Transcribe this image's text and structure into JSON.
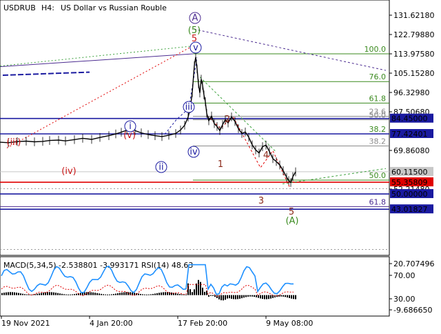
{
  "header": {
    "symbol": "USDRUB",
    "timeframe": "H4:",
    "description": "US Dollar vs Russian Rouble"
  },
  "colors": {
    "fib_green": "#3a8a1e",
    "line_blue": "#1a1aa0",
    "line_red": "#e00000",
    "wave_red": "#c81414",
    "wave_brown": "#8b2a1a",
    "wave_purple": "#4b2b90",
    "label_blue_bg": "#1a1aa0",
    "label_red_bg": "#e00000",
    "label_gray_bg": "#c8c8c8",
    "macd_blue": "#1e90ff"
  },
  "price_axis": [
    {
      "value": 131.6218,
      "text": "131.62180"
    },
    {
      "value": 122.7988,
      "text": "122.79880"
    },
    {
      "value": 113.9758,
      "text": "113.97580"
    },
    {
      "value": 105.1528,
      "text": "105.15280"
    },
    {
      "value": 96.3298,
      "text": "96.32980"
    },
    {
      "value": 87.5068,
      "text": "87.50680"
    },
    {
      "value": 69.8608,
      "text": "69.86080"
    },
    {
      "value": 52.2148,
      "text": "52.21480"
    }
  ],
  "price_labels": [
    {
      "value": 84.45,
      "text": "84.45000",
      "kind": "blue"
    },
    {
      "value": 77.42401,
      "text": "77.42401",
      "kind": "blue"
    },
    {
      "value": 60.115,
      "text": "60.11500",
      "kind": "gray"
    },
    {
      "value": 55.35809,
      "text": "55.35809",
      "kind": "red"
    },
    {
      "value": 50.0,
      "text": "50.00000",
      "kind": "blue"
    },
    {
      "value": 43.01827,
      "text": "43.01827",
      "kind": "blue"
    }
  ],
  "fib_levels": [
    {
      "value": 113.9758,
      "text": "100.0",
      "color": "green"
    },
    {
      "value": 101.3,
      "text": "76.0",
      "color": "green"
    },
    {
      "value": 91.5,
      "text": "61.8",
      "color": "green"
    },
    {
      "value": 85.45,
      "text": "23.6",
      "color": "gray"
    },
    {
      "value": 83.9,
      "text": "50.0",
      "color": "gray"
    },
    {
      "value": 77.42401,
      "text": "38.2",
      "color": "green"
    },
    {
      "value": 71.9,
      "text": "38.2",
      "color": "gray"
    },
    {
      "value": 56.3,
      "text": "50.0",
      "color": "green"
    },
    {
      "value": 44.2,
      "text": "61.8",
      "color": "purple"
    }
  ],
  "wave_labels": [
    {
      "text": "A",
      "style": "circle-purple"
    },
    {
      "text": "(5)",
      "style": "green"
    },
    {
      "text": "5",
      "style": "red"
    },
    {
      "text": "v",
      "style": "circle-blue"
    },
    {
      "text": "iii",
      "style": "circle-blue"
    },
    {
      "text": "i",
      "style": "circle-blue"
    },
    {
      "text": "ii",
      "style": "circle-blue"
    },
    {
      "text": "iv",
      "style": "circle-blue"
    },
    {
      "text": "(iii)",
      "style": "red"
    },
    {
      "text": "(v)",
      "style": "red"
    },
    {
      "text": "(iv)",
      "style": "red"
    },
    {
      "text": "1",
      "style": "brown"
    },
    {
      "text": "2",
      "style": "brown"
    },
    {
      "text": "3",
      "style": "brown"
    },
    {
      "text": "4",
      "style": "brown"
    },
    {
      "text": "5",
      "style": "brown"
    },
    {
      "text": "(A)",
      "style": "green"
    }
  ],
  "macd": {
    "label": "MACD(5,34,5) -2.538801 -3.993171 RSI(14) 48.63",
    "axis": [
      {
        "value": 20.707496,
        "text": "20.707496"
      },
      {
        "value": 70.0,
        "text": "70.00"
      },
      {
        "value": 30.0,
        "text": "30.00"
      },
      {
        "value": -9.68665,
        "text": "-9.686650"
      }
    ]
  },
  "time_axis": [
    "19 Nov 2021",
    "4 Jan 20:00",
    "17 Feb 20:00",
    "9 May 08:00"
  ],
  "chart_data": {
    "type": "line",
    "title": "USDRUB, H4: US Dollar vs Russian Rouble",
    "ylim": [
      38.0,
      133.0
    ],
    "x": [
      "19 Nov 2021",
      "4 Jan 20:00",
      "17 Feb 20:00",
      "9 May 08:00"
    ],
    "series": [
      {
        "name": "USDRUB",
        "points": [
          [
            0,
            73.6
          ],
          [
            12,
            73.4
          ],
          [
            25,
            73.9
          ],
          [
            38,
            74.1
          ],
          [
            50,
            73.8
          ],
          [
            62,
            74.0
          ],
          [
            72,
            74.4
          ],
          [
            85,
            74.6
          ],
          [
            95,
            74.2
          ],
          [
            108,
            74.8
          ],
          [
            120,
            75.4
          ],
          [
            133,
            74.9
          ],
          [
            145,
            75.8
          ],
          [
            158,
            76.6
          ],
          [
            168,
            77.4
          ],
          [
            176,
            78.2
          ],
          [
            184,
            79.1
          ],
          [
            190,
            80.6
          ],
          [
            196,
            78.9
          ],
          [
            205,
            77.9
          ],
          [
            215,
            77.1
          ],
          [
            225,
            76.6
          ],
          [
            235,
            76.2
          ],
          [
            245,
            76.8
          ],
          [
            255,
            77.6
          ],
          [
            262,
            79.2
          ],
          [
            268,
            81.4
          ],
          [
            273,
            85.1
          ],
          [
            276,
            88.9
          ],
          [
            279,
            96.2
          ],
          [
            282,
            108.6
          ],
          [
            284,
            112.5
          ],
          [
            286,
            107.1
          ],
          [
            288,
            100.3
          ],
          [
            290,
            96.1
          ],
          [
            292,
            102.4
          ],
          [
            294,
            99.6
          ],
          [
            296,
            95.2
          ],
          [
            298,
            92.1
          ],
          [
            300,
            86.8
          ],
          [
            303,
            83.4
          ],
          [
            307,
            85.6
          ],
          [
            311,
            82.1
          ],
          [
            315,
            80.8
          ],
          [
            319,
            78.9
          ],
          [
            323,
            81.6
          ],
          [
            327,
            83.9
          ],
          [
            331,
            82.4
          ],
          [
            336,
            85.2
          ],
          [
            341,
            83.1
          ],
          [
            346,
            79.8
          ],
          [
            351,
            77.6
          ],
          [
            356,
            78.3
          ],
          [
            361,
            75.9
          ],
          [
            366,
            72.4
          ],
          [
            371,
            70.1
          ],
          [
            376,
            68.7
          ],
          [
            381,
            71.6
          ],
          [
            386,
            72.3
          ],
          [
            391,
            69.4
          ],
          [
            396,
            66.1
          ],
          [
            401,
            64.8
          ],
          [
            406,
            63.2
          ],
          [
            411,
            60.6
          ],
          [
            416,
            57.6
          ],
          [
            419,
            56.1
          ],
          [
            422,
            55.2
          ],
          [
            425,
            57.9
          ],
          [
            429,
            60.1
          ]
        ]
      }
    ]
  }
}
